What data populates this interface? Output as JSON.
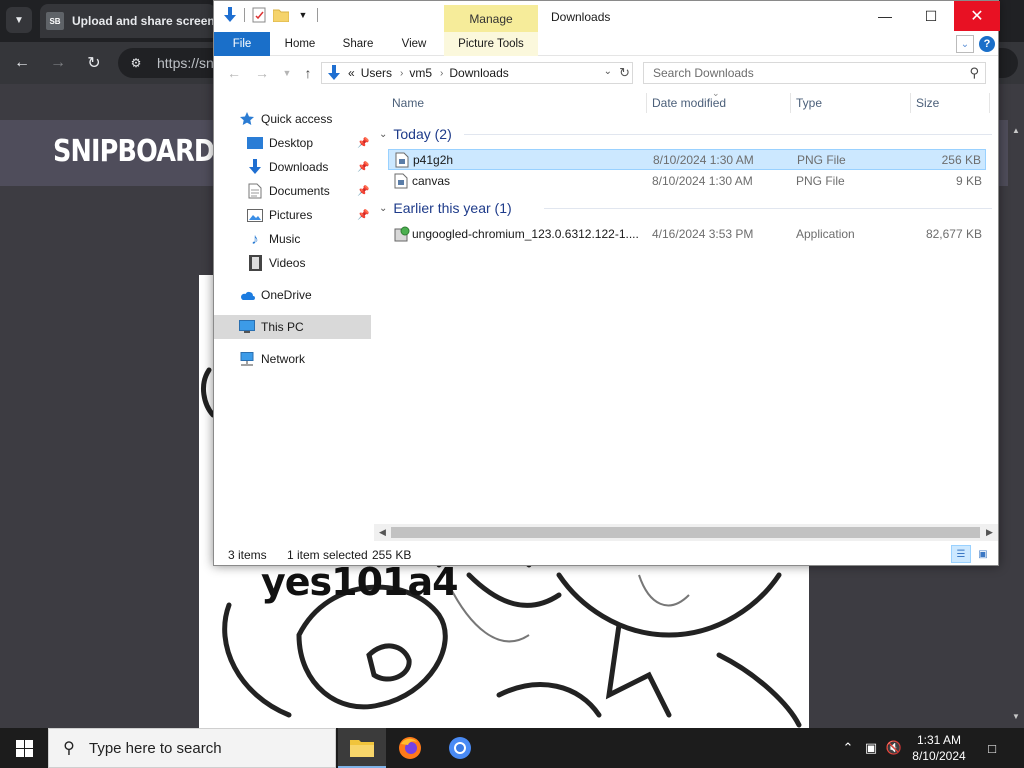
{
  "browser": {
    "tab_title": "Upload and share screensh",
    "tab_favicon": "SB",
    "url": "https://sn",
    "site_logo": "SNIPBOARD.IO",
    "image_caption": "yes101a4"
  },
  "explorer": {
    "title": "Downloads",
    "manage_label": "Manage",
    "ribbon_tabs": [
      "File",
      "Home",
      "Share",
      "View",
      "Picture Tools"
    ],
    "address": {
      "overflow": "«",
      "crumbs": [
        "Users",
        "vm5",
        "Downloads"
      ]
    },
    "search_placeholder": "Search Downloads",
    "nav_items": [
      {
        "label": "Quick access",
        "icon": "star-icon",
        "pinned": false
      },
      {
        "label": "Desktop",
        "icon": "desktop-icon",
        "pinned": true
      },
      {
        "label": "Downloads",
        "icon": "download-arrow-icon",
        "pinned": true
      },
      {
        "label": "Documents",
        "icon": "documents-icon",
        "pinned": true
      },
      {
        "label": "Pictures",
        "icon": "pictures-icon",
        "pinned": true
      },
      {
        "label": "Music",
        "icon": "music-note-icon",
        "pinned": false
      },
      {
        "label": "Videos",
        "icon": "film-icon",
        "pinned": false
      },
      {
        "label": "OneDrive",
        "icon": "cloud-icon",
        "pinned": false
      },
      {
        "label": "This PC",
        "icon": "monitor-icon",
        "pinned": false,
        "selected": true
      },
      {
        "label": "Network",
        "icon": "network-icon",
        "pinned": false
      }
    ],
    "columns": [
      "Name",
      "Date modified",
      "Type",
      "Size"
    ],
    "groups": [
      {
        "label": "Today (2)",
        "files": [
          {
            "name": "p41g2h",
            "date": "8/10/2024 1:30 AM",
            "type": "PNG File",
            "size": "256 KB",
            "selected": true,
            "icon": "png-file-icon"
          },
          {
            "name": "canvas",
            "date": "8/10/2024 1:30 AM",
            "type": "PNG File",
            "size": "9 KB",
            "selected": false,
            "icon": "png-file-icon"
          }
        ]
      },
      {
        "label": "Earlier this year (1)",
        "files": [
          {
            "name": "ungoogled-chromium_123.0.6312.122-1....",
            "date": "4/16/2024 3:53 PM",
            "type": "Application",
            "size": "82,677 KB",
            "selected": false,
            "icon": "installer-icon"
          }
        ]
      }
    ],
    "status": {
      "item_count": "3 items",
      "selection": "1 item selected",
      "selection_size": "255 KB"
    }
  },
  "taskbar": {
    "search_placeholder": "Type here to search",
    "time": "1:31 AM",
    "date": "8/10/2024"
  },
  "colors": {
    "accent": "#1a6fc9",
    "close": "#e81123",
    "selection": "#cce8ff",
    "manage_tab": "#f6ec9a",
    "group_header": "#1e3b8a"
  }
}
